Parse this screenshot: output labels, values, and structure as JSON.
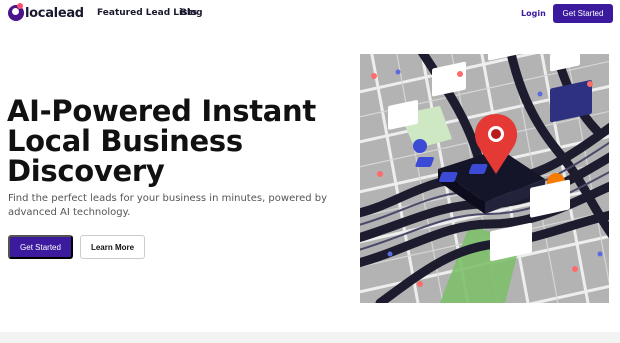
{
  "brand": {
    "name": "localead"
  },
  "nav": {
    "links": [
      "Featured Lead Lists",
      "Blog"
    ],
    "login": "Login",
    "cta": "Get Started"
  },
  "hero": {
    "title_line1": "AI-Powered Instant",
    "title_line2": "Local Business",
    "title_line3": "Discovery",
    "subtitle": "Find the perfect leads for your business in minutes, powered by advanced AI technology.",
    "primary_button": "Get Started",
    "secondary_button": "Learn More"
  },
  "colors": {
    "brand": "#3b1a9e",
    "accent": "#ff4d6d",
    "pin": "#e53935"
  }
}
